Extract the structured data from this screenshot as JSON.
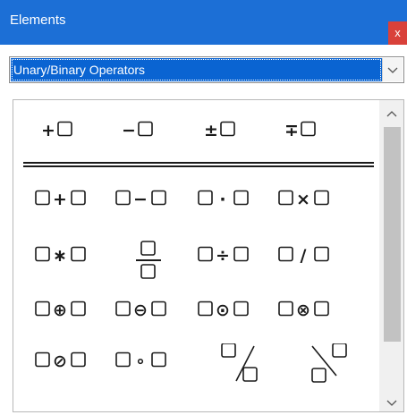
{
  "window": {
    "title": "Elements",
    "close_label": "x"
  },
  "dropdown": {
    "selected": "Unary/Binary Operators"
  },
  "icons": {
    "close": "close-icon",
    "dropdown_arrow": "chevron-down-icon",
    "scroll_up": "scroll-up-arrow-icon",
    "scroll_down": "scroll-down-arrow-icon"
  },
  "elements": {
    "unary": [
      {
        "name": "unary-plus",
        "symbol": "+"
      },
      {
        "name": "unary-minus",
        "symbol": "−"
      },
      {
        "name": "unary-plus-minus",
        "symbol": "±"
      },
      {
        "name": "unary-minus-plus",
        "symbol": "∓"
      }
    ],
    "binary": [
      {
        "name": "addition",
        "symbol": "+"
      },
      {
        "name": "subtraction",
        "symbol": "−"
      },
      {
        "name": "multiplication-dot",
        "symbol": "·"
      },
      {
        "name": "multiplication-x",
        "symbol": "×"
      },
      {
        "name": "multiplication-asterisk",
        "symbol": "∗"
      },
      {
        "name": "fraction",
        "symbol": ""
      },
      {
        "name": "division",
        "symbol": "÷"
      },
      {
        "name": "division-slash",
        "symbol": "/"
      },
      {
        "name": "circled-plus",
        "symbol": "⊕"
      },
      {
        "name": "circled-minus",
        "symbol": "⊖"
      },
      {
        "name": "circled-dot",
        "symbol": "⊙"
      },
      {
        "name": "circled-times",
        "symbol": "⊗"
      },
      {
        "name": "circled-slash",
        "symbol": "⊘"
      },
      {
        "name": "small-circle",
        "symbol": "∘"
      },
      {
        "name": "wide-slash",
        "symbol": ""
      },
      {
        "name": "wide-backslash",
        "symbol": ""
      }
    ]
  },
  "colors": {
    "titlebar": "#1c6fd6",
    "selection": "#0a64d2",
    "close": "#d9413a"
  }
}
